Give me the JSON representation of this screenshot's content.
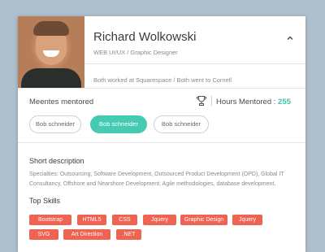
{
  "profile": {
    "name": "Richard Wolkowski",
    "role": "WEB UI/UX / Graphic Designer",
    "shared": "Both worked at Squarespace /  Both went to Cornell"
  },
  "mentoring": {
    "mentored_label": "Meentes mentored",
    "hours_label": "Hours Mentored : ",
    "hours_value": "255",
    "mentees": [
      {
        "label": "Bob schneider",
        "active": false
      },
      {
        "label": "Bob schneider",
        "active": true
      },
      {
        "label": "Bob schneider",
        "active": false
      }
    ]
  },
  "description": {
    "title": "Short description",
    "text": "Specialties: Outsourcing, Software Development, Outsourced Product Development (OPD), Global IT Consultancy, Offshore and Nearshore Development, Agile methodologies, database development,"
  },
  "skills": {
    "title": "Top Skills",
    "items": [
      "Bootstrap",
      "HTML5",
      "CSS",
      "Jquery",
      "Graphic Design",
      "Jquery",
      "SVG",
      "Art Direction",
      ".NET"
    ]
  },
  "icons": {
    "collapse": "chevron-up-icon",
    "trophy": "trophy-icon"
  },
  "colors": {
    "accent": "#45cbb1",
    "hours": "#3cc6a8",
    "skill_tag": "#ef6352",
    "background": "#aebfcd"
  }
}
